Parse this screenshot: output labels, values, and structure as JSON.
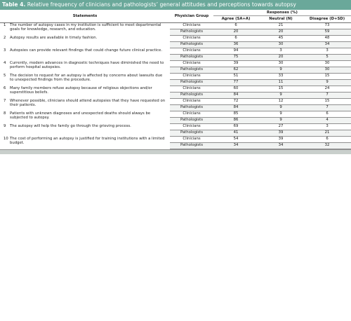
{
  "title": {
    "label": "Table 4.",
    "text": " Relative frequency of clinicians and pathologists’ general attitudes and perceptions towards autopsy"
  },
  "headers": {
    "statements": "Statements",
    "physician_group": "Physician Group",
    "responses": "Responses (%)",
    "agree": "Agree (SA+A)",
    "neutral": "Neutral (N)",
    "disagree": "Disagree (D+SD)"
  },
  "rows": [
    {
      "num": "1",
      "statement": "The number of autopsy cases in my institution is sufficient to meet departmental goals for knowledge, research, and education.",
      "clinicians": {
        "group": "Clinicians",
        "agree": "6",
        "neutral": "21",
        "disagree": "73"
      },
      "pathologists": {
        "group": "Pathologists",
        "agree": "20",
        "neutral": "20",
        "disagree": "59"
      }
    },
    {
      "num": "2",
      "statement": "Autopsy results are available in timely fashion.",
      "clinicians": {
        "group": "Clinicians",
        "agree": "6",
        "neutral": "45",
        "disagree": "48"
      },
      "pathologists": {
        "group": "Pathologists",
        "agree": "36",
        "neutral": "30",
        "disagree": "34"
      }
    },
    {
      "num": "3",
      "statement": "Autopsies can provide relevant findings that could change future clinical practice.",
      "clinicians": {
        "group": "Clinicians",
        "agree": "94",
        "neutral": "3",
        "disagree": "3"
      },
      "pathologists": {
        "group": "Pathologists",
        "agree": "75",
        "neutral": "20",
        "disagree": "5"
      }
    },
    {
      "num": "4",
      "statement": "Currently, modern advances in diagnostic techniques have diminished the need to perform hospital autopsies.",
      "clinicians": {
        "group": "Clinicians",
        "agree": "39",
        "neutral": "30",
        "disagree": "30"
      },
      "pathologists": {
        "group": "Pathologists",
        "agree": "62",
        "neutral": "9",
        "disagree": "30"
      }
    },
    {
      "num": "5",
      "statement": "The decision to request for an autopsy is affected by concerns about lawsuits due to unexpected findings from the procedure.",
      "clinicians": {
        "group": "Clinicians",
        "agree": "51",
        "neutral": "33",
        "disagree": "15"
      },
      "pathologists": {
        "group": "Pathologists",
        "agree": "77",
        "neutral": "11",
        "disagree": "9"
      }
    },
    {
      "num": "6",
      "statement": "Many family members refuse autopsy because of religious objections and/or superstitious beliefs.",
      "clinicians": {
        "group": "Clinicians",
        "agree": "60",
        "neutral": "15",
        "disagree": "24"
      },
      "pathologists": {
        "group": "Pathologists",
        "agree": "84",
        "neutral": "9",
        "disagree": "7"
      }
    },
    {
      "num": "7",
      "statement": "Whenever possible, clinicians should attend autopsies that they have requested on their patients.",
      "clinicians": {
        "group": "Clinicians",
        "agree": "72",
        "neutral": "12",
        "disagree": "15"
      },
      "pathologists": {
        "group": "Pathologists",
        "agree": "84",
        "neutral": "9",
        "disagree": "7"
      }
    },
    {
      "num": "8",
      "statement": "Patients with unknown diagnoses and unexpected deaths should always be subjected to autopsy.",
      "clinicians": {
        "group": "Clinicians",
        "agree": "85",
        "neutral": "9",
        "disagree": "6"
      },
      "pathologists": {
        "group": "Pathologists",
        "agree": "86",
        "neutral": "9",
        "disagree": "4"
      }
    },
    {
      "num": "9",
      "statement": "The autopsy will help the family go through the grieving process.",
      "clinicians": {
        "group": "Clinicians",
        "agree": "69",
        "neutral": "27",
        "disagree": "3"
      },
      "pathologists": {
        "group": "Pathologists",
        "agree": "41",
        "neutral": "39",
        "disagree": "21"
      }
    },
    {
      "num": "10",
      "statement": "The cost of performing an autopsy is justified for training institutions with a limited budget.",
      "clinicians": {
        "group": "Clinicians",
        "agree": "54",
        "neutral": "39",
        "disagree": "6"
      },
      "pathologists": {
        "group": "Pathologists",
        "agree": "34",
        "neutral": "34",
        "disagree": "32"
      }
    }
  ]
}
